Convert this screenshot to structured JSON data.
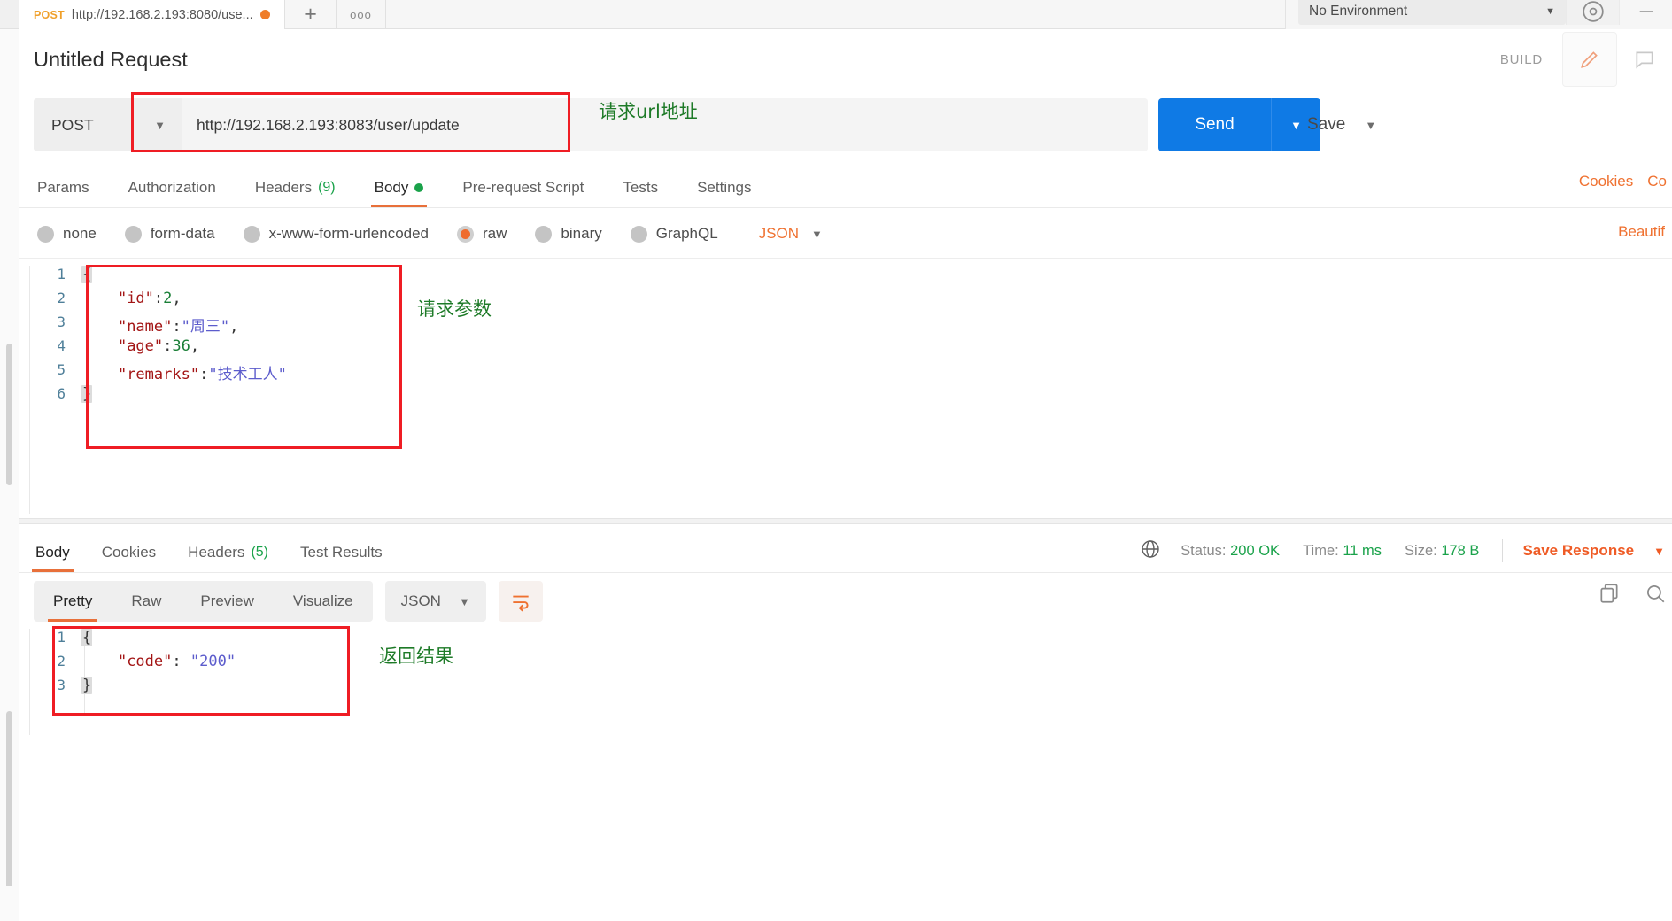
{
  "tab": {
    "method": "POST",
    "url_short": "http://192.168.2.193:8080/use...",
    "plus": "+",
    "more": "ooo"
  },
  "environment": {
    "selected": "No Environment",
    "caret": "▼"
  },
  "header": {
    "request_title": "Untitled Request",
    "build_label": "BUILD"
  },
  "request": {
    "method": "POST",
    "method_caret": "▼",
    "url": "http://192.168.2.193:8083/user/update",
    "send_label": "Send",
    "send_caret": "▼",
    "save_label": "Save",
    "save_caret": "▼"
  },
  "request_tabs": [
    {
      "label": "Params",
      "active": false
    },
    {
      "label": "Authorization",
      "active": false
    },
    {
      "label": "Headers",
      "count": "(9)",
      "active": false
    },
    {
      "label": "Body",
      "dot": true,
      "active": true
    },
    {
      "label": "Pre-request Script",
      "active": false
    },
    {
      "label": "Tests",
      "active": false
    },
    {
      "label": "Settings",
      "active": false
    }
  ],
  "request_tabs_right": [
    {
      "label": "Cookies"
    },
    {
      "label": "Co"
    }
  ],
  "body_types": [
    {
      "label": "none",
      "selected": false
    },
    {
      "label": "form-data",
      "selected": false
    },
    {
      "label": "x-www-form-urlencoded",
      "selected": false
    },
    {
      "label": "raw",
      "selected": true
    },
    {
      "label": "binary",
      "selected": false
    },
    {
      "label": "GraphQL",
      "selected": false
    }
  ],
  "body_format": {
    "label": "JSON",
    "caret": "▼"
  },
  "beautify_label": "Beautif",
  "request_body": {
    "lines": [
      {
        "n": "1",
        "text": "{"
      },
      {
        "n": "2",
        "text": "    \"id\":2,"
      },
      {
        "n": "3",
        "text": "    \"name\":\"周三\","
      },
      {
        "n": "4",
        "text": "    \"age\":36,"
      },
      {
        "n": "5",
        "text": "    \"remarks\":\"技术工人\""
      },
      {
        "n": "6",
        "text": "}"
      }
    ]
  },
  "response_tabs": [
    {
      "label": "Body",
      "active": true
    },
    {
      "label": "Cookies",
      "active": false
    },
    {
      "label": "Headers",
      "count": "(5)",
      "active": false
    },
    {
      "label": "Test Results",
      "active": false
    }
  ],
  "response_status": {
    "status_label": "Status:",
    "status_value": "200 OK",
    "time_label": "Time:",
    "time_value": "11 ms",
    "size_label": "Size:",
    "size_value": "178 B",
    "save_response": "Save Response",
    "save_response_caret": "▼"
  },
  "response_view_tabs": [
    {
      "label": "Pretty",
      "active": true
    },
    {
      "label": "Raw",
      "active": false
    },
    {
      "label": "Preview",
      "active": false
    },
    {
      "label": "Visualize",
      "active": false
    }
  ],
  "response_format": {
    "label": "JSON",
    "caret": "▼"
  },
  "response_body": {
    "lines": [
      {
        "n": "1",
        "text": "{"
      },
      {
        "n": "2",
        "text": "    \"code\": \"200\""
      },
      {
        "n": "3",
        "text": "}"
      }
    ]
  },
  "annotations": [
    {
      "id": "url",
      "text": "请求url地址"
    },
    {
      "id": "params",
      "text": "请求参数"
    },
    {
      "id": "response",
      "text": "返回结果"
    }
  ],
  "colors": {
    "accent_orange": "#ef7130",
    "send_blue": "#0f7ae5",
    "success_green": "#1aa24a",
    "annotation_green": "#1d7a27",
    "highlight_red": "#ef1d24"
  }
}
